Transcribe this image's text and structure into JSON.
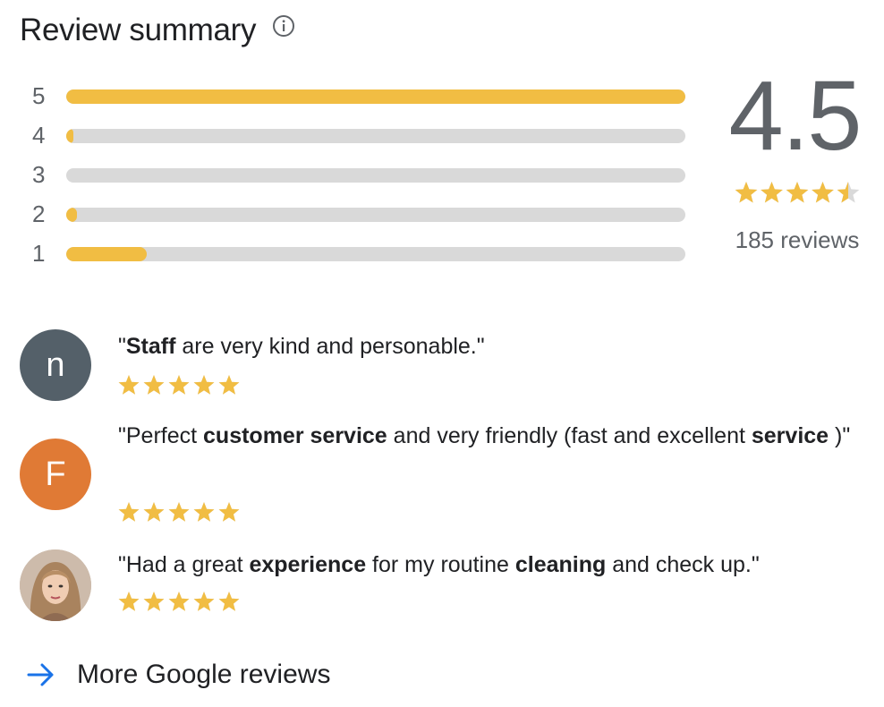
{
  "header": {
    "title": "Review summary",
    "info_icon": "info-circle-icon"
  },
  "histogram": [
    {
      "label": "5",
      "fraction": 1.0
    },
    {
      "label": "4",
      "fraction": 0.012
    },
    {
      "label": "3",
      "fraction": 0.0
    },
    {
      "label": "2",
      "fraction": 0.018
    },
    {
      "label": "1",
      "fraction": 0.13
    }
  ],
  "summary": {
    "score": "4.5",
    "stars": 4.5,
    "review_count": "185 reviews"
  },
  "reviews": [
    {
      "avatar_letter": "n",
      "avatar_color": "#546069",
      "segments": [
        {
          "text": "\"",
          "bold": false
        },
        {
          "text": "Staff",
          "bold": true
        },
        {
          "text": " are very kind and personable.\"",
          "bold": false
        }
      ],
      "stars": 5
    },
    {
      "avatar_letter": "F",
      "avatar_color": "#e07a35",
      "segments": [
        {
          "text": "\"Perfect ",
          "bold": false
        },
        {
          "text": "customer service",
          "bold": true
        },
        {
          "text": " and very friendly (fast and excellent ",
          "bold": false
        },
        {
          "text": "service",
          "bold": true
        },
        {
          "text": " )\"",
          "bold": false
        }
      ],
      "stars": 5
    },
    {
      "avatar_letter": "",
      "avatar_color": "#c9b6a6",
      "avatar_photo": "woman-portrait",
      "segments": [
        {
          "text": "\"Had a great ",
          "bold": false
        },
        {
          "text": "experience",
          "bold": true
        },
        {
          "text": " for my routine ",
          "bold": false
        },
        {
          "text": "cleaning",
          "bold": true
        },
        {
          "text": " and check up.\"",
          "bold": false
        }
      ],
      "stars": 5
    }
  ],
  "more_link": {
    "label": "More Google reviews",
    "icon": "arrow-right-icon"
  },
  "colors": {
    "star": "#f1bd43",
    "track": "#d9d9d9",
    "text_secondary": "#5f6368",
    "link_arrow": "#1a73e8"
  }
}
